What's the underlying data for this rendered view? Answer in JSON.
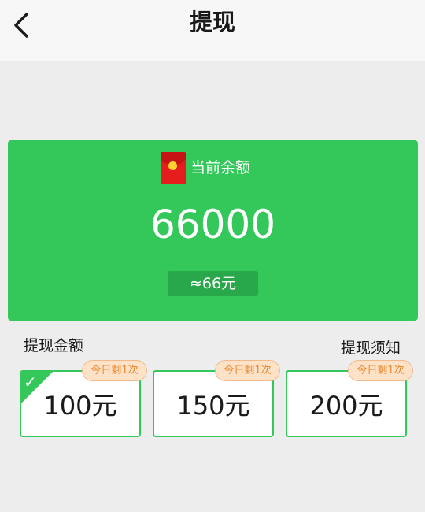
{
  "header": {
    "title": "提现",
    "back_icon": "chevron-left-icon"
  },
  "balance": {
    "icon": "red-packet-icon",
    "label": "当前余额",
    "amount": "66000",
    "approx": "≈66元"
  },
  "section": {
    "amount_label": "提现金额",
    "notice_label": "提现须知"
  },
  "options": [
    {
      "amount": "100元",
      "badge": "今日剩1次",
      "selected": true
    },
    {
      "amount": "150元",
      "badge": "今日剩1次",
      "selected": false
    },
    {
      "amount": "200元",
      "badge": "今日剩1次",
      "selected": false
    }
  ],
  "colors": {
    "accent_green": "#34c85a",
    "badge_bg": "#fde2c7",
    "badge_text": "#e8882f",
    "red_packet": "#e51d1d"
  }
}
